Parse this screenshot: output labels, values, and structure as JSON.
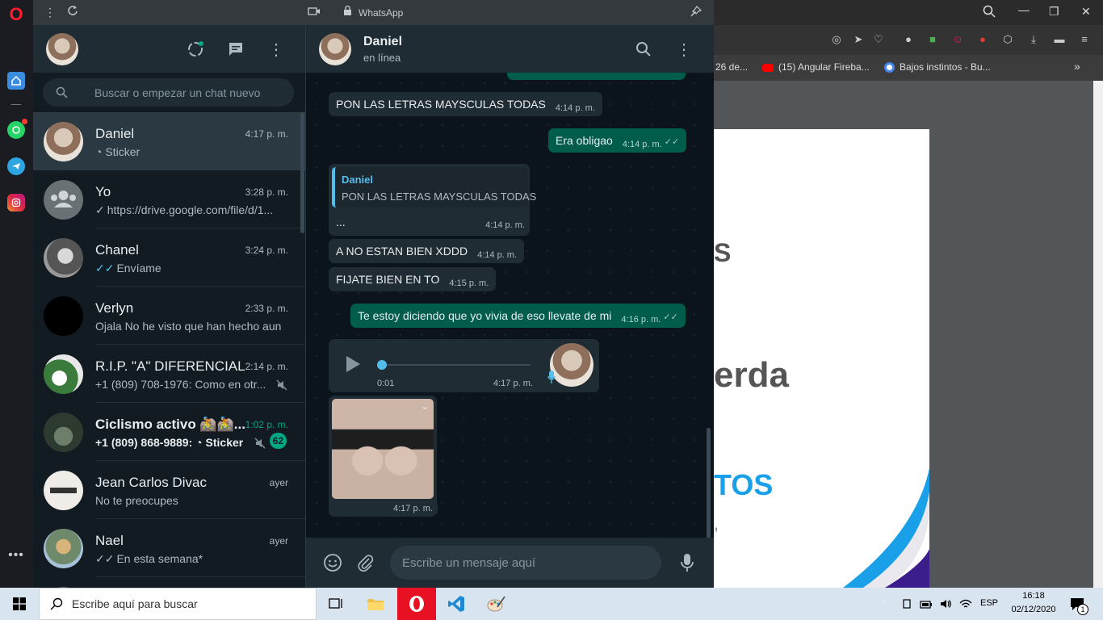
{
  "window": {
    "url": "WhatsApp"
  },
  "search": {
    "placeholder": "Buscar o empezar un chat nuevo"
  },
  "chats": [
    {
      "name": "Daniel",
      "time": "4:17 p. m.",
      "preview": "Sticker"
    },
    {
      "name": "Yo",
      "time": "3:28 p. m.",
      "preview": "https://drive.google.com/file/d/1..."
    },
    {
      "name": "Chanel",
      "time": "3:24 p. m.",
      "preview": "Envíame"
    },
    {
      "name": "Verlyn",
      "time": "2:33 p. m.",
      "preview": "Ojala  No he visto que han hecho aun"
    },
    {
      "name": "R.I.P. \"A\" DIFERENCIAL",
      "time": "2:14 p. m.",
      "preview": "+1 (809) 708-1976: Como en otr..."
    },
    {
      "name": "Ciclismo activo 🚵🚵...",
      "time": "1:02 p. m.",
      "preview_sender": "+1 (809) 868-9889:",
      "preview": "Sticker",
      "unread": "62"
    },
    {
      "name": "Jean Carlos Divac",
      "time": "ayer",
      "preview": "No te preocupes"
    },
    {
      "name": "Nael",
      "time": "ayer",
      "preview": "En esta semana*"
    }
  ],
  "conversation": {
    "name": "Daniel",
    "status": "en línea",
    "messages": [
      {
        "text": "PON LAS LETRAS MAYSCULAS TODAS",
        "time": "4:14 p. m."
      },
      {
        "text": "Era obligao",
        "time": "4:14 p. m."
      },
      {
        "quote_author": "Daniel",
        "quote_text": "PON LAS LETRAS MAYSCULAS TODAS",
        "text": "...",
        "time": "4:14 p. m."
      },
      {
        "text": "A NO ESTAN BIEN XDDD",
        "time": "4:14 p. m."
      },
      {
        "text": "FIJATE BIEN EN TO",
        "time": "4:15 p. m."
      },
      {
        "text": "Te estoy diciendo que yo vivia de eso llevate de mi",
        "time": "4:16 p. m."
      },
      {
        "duration": "0:01",
        "time": "4:17 p. m."
      },
      {
        "time": "4:17 p. m."
      }
    ],
    "input_placeholder": "Escribe un mensaje aquí"
  },
  "browser_bg": {
    "bookmarks": [
      "26 de...",
      "(15) Angular Fireba...",
      "Bajos instintos - Bu..."
    ],
    "doc_fragments": [
      "S",
      "erda",
      "TOS",
      ","
    ]
  },
  "taskbar": {
    "search_placeholder": "Escribe aquí para buscar",
    "lang": "ESP",
    "time": "16:18",
    "date": "02/12/2020",
    "notifications": "1"
  },
  "colors": {
    "wa_dark": "#111b21",
    "wa_header": "#202c33",
    "wa_green": "#00a884",
    "out_bubble": "#005c4b",
    "in_bubble": "#202c33",
    "read_tick": "#53bdeb",
    "opera_red": "#ff1b2d"
  }
}
